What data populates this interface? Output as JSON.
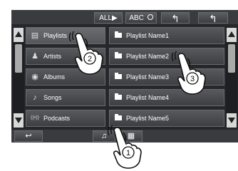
{
  "topbar": {
    "all_label": "ALL▶",
    "abc_label": "ABC",
    "search_glyph": "🔍",
    "up_level_glyph": "↰",
    "back_glyph": "↰"
  },
  "categories": [
    {
      "label": "Playlists",
      "icon": "playlist-icon",
      "glyph": "▤"
    },
    {
      "label": "Artists",
      "icon": "artist-icon",
      "glyph": "♟"
    },
    {
      "label": "Albums",
      "icon": "album-icon",
      "glyph": "◉"
    },
    {
      "label": "Songs",
      "icon": "song-icon",
      "glyph": "♪"
    },
    {
      "label": "Podcasts",
      "icon": "podcast-icon",
      "glyph": "((•))"
    }
  ],
  "items": [
    {
      "label": "Playlist Name1"
    },
    {
      "label": "Playlist Name2"
    },
    {
      "label": "Playlist Name3"
    },
    {
      "label": "Playlist Name4"
    },
    {
      "label": "Playlist Name5"
    }
  ],
  "bottom": {
    "return_glyph": "↩",
    "music_glyph": "♫",
    "video_glyph": "▦"
  },
  "callouts": [
    "1",
    "2",
    "3"
  ]
}
